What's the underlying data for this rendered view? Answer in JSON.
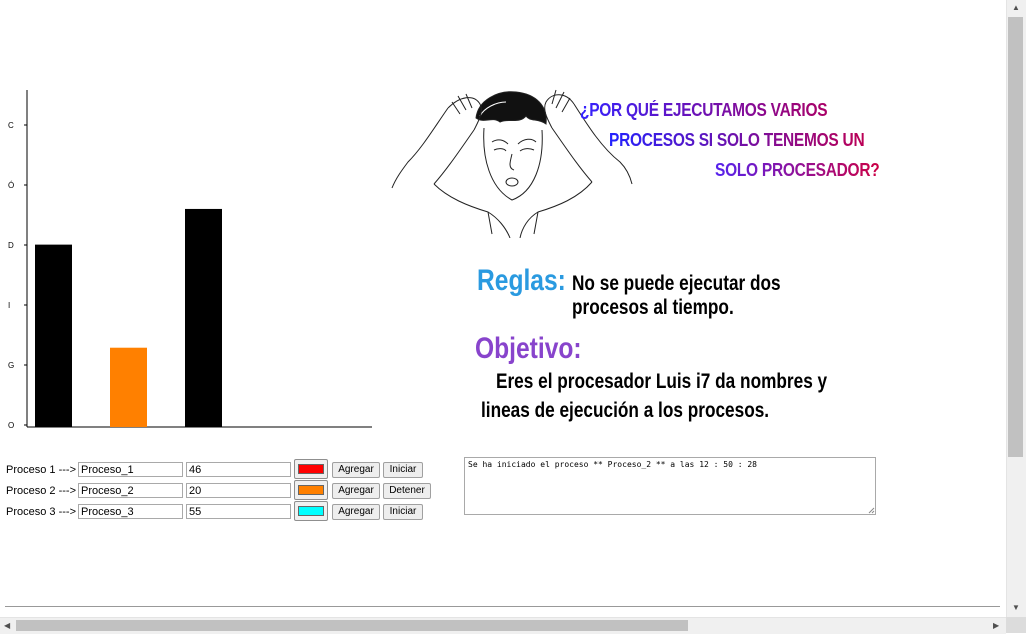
{
  "chart_data": {
    "type": "bar",
    "ylabel_letters": [
      "C",
      "Ó",
      "D",
      "I",
      "G",
      "O"
    ],
    "categories": [
      "Proceso_1",
      "Proceso_2",
      "Proceso_3"
    ],
    "values": [
      46,
      20,
      55
    ],
    "bar_colors": [
      "#000000",
      "#ff8000",
      "#000000"
    ],
    "ylim": [
      0,
      85
    ]
  },
  "headline": {
    "line1": "¿POR QUÉ EJECUTAMOS VARIOS",
    "line2": "PROCESOS SI SOLO TENEMOS UN",
    "line3": "SOLO PROCESADOR?"
  },
  "rules": {
    "heading": "Reglas:",
    "text_line1": "No se puede ejecutar dos",
    "text_line2": "procesos al tiempo."
  },
  "objective": {
    "heading": "Objetivo:",
    "text_line1": "Eres el procesador Luis i7 da nombres y",
    "text_line2": "lineas de ejecución a los procesos."
  },
  "processes": [
    {
      "label": "Proceso 1 --->",
      "name": "Proceso_1",
      "lines": "46",
      "color": "#ff0000",
      "add_label": "Agregar",
      "action_label": "Iniciar"
    },
    {
      "label": "Proceso 2 --->",
      "name": "Proceso_2",
      "lines": "20",
      "color": "#ff8000",
      "add_label": "Agregar",
      "action_label": "Detener"
    },
    {
      "label": "Proceso 3 --->",
      "name": "Proceso_3",
      "lines": "55",
      "color": "#00ffff",
      "add_label": "Agregar",
      "action_label": "Iniciar"
    }
  ],
  "log": {
    "text": "Se ha iniciado el proceso ** Proceso_2 ** a las 12 : 50 : 28"
  }
}
